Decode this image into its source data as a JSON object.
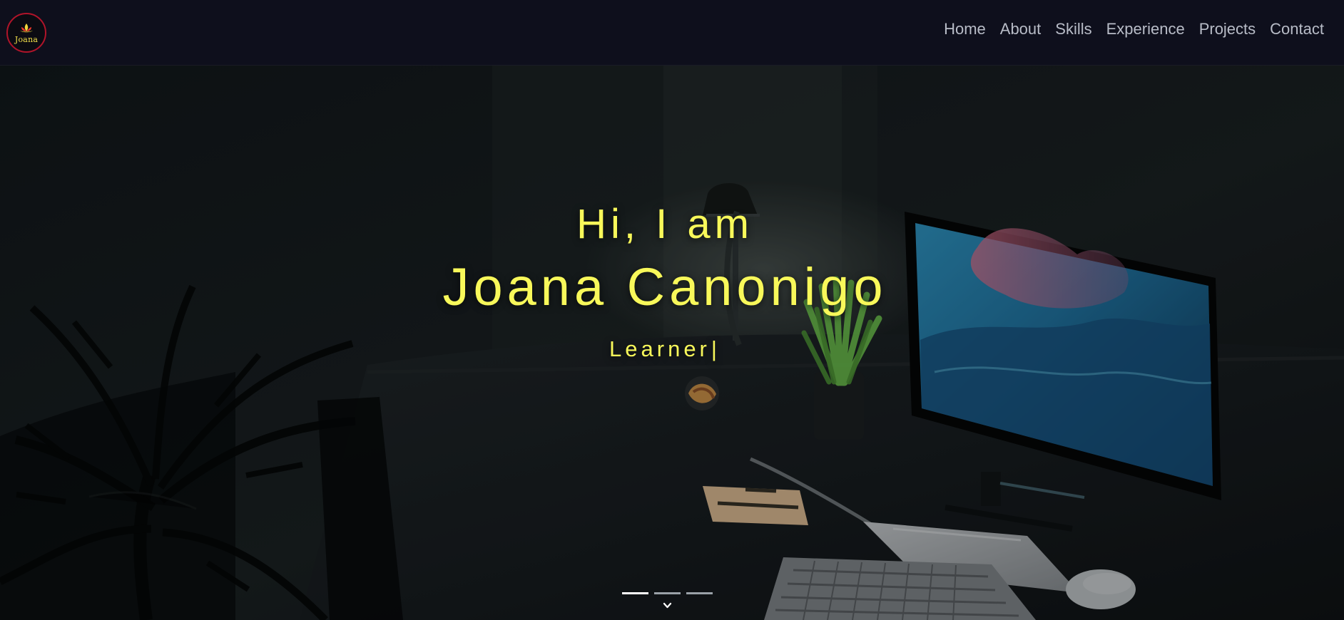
{
  "brand": {
    "logo_text": "Joana",
    "logo_icon": "lotus-icon",
    "accent_color": "#f3e14a",
    "ring_color": "#b0142a"
  },
  "nav": {
    "items": [
      {
        "label": "Home"
      },
      {
        "label": "About"
      },
      {
        "label": "Skills"
      },
      {
        "label": "Experience"
      },
      {
        "label": "Projects"
      },
      {
        "label": "Contact"
      }
    ]
  },
  "hero": {
    "greeting": "Hi, I am",
    "name": "Joana Canonigo",
    "role": "Learner",
    "cursor": "|",
    "text_color": "#f8f85a"
  },
  "carousel": {
    "active_index": 0,
    "indicator_count": 3
  },
  "icons": {
    "scroll_down": "chevron-down-icon"
  }
}
